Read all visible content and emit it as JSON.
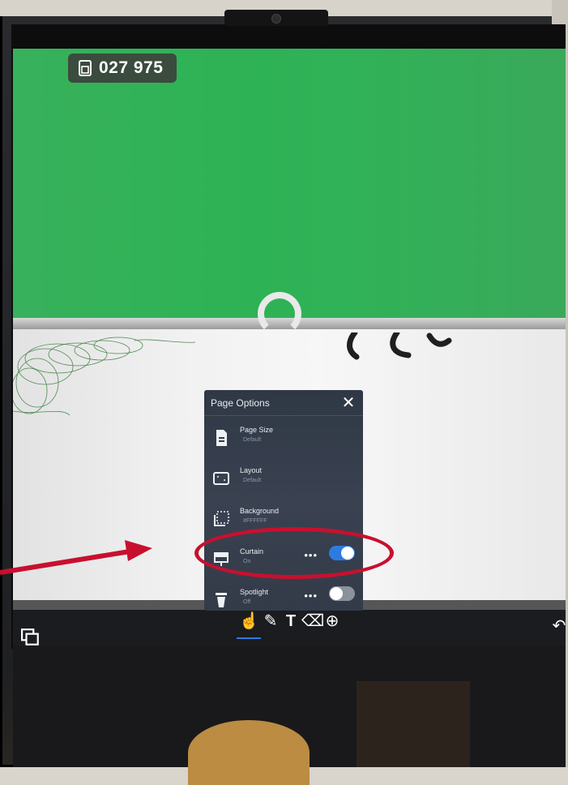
{
  "session_code": "027 975",
  "panel": {
    "title": "Page Options",
    "options": [
      {
        "label": "Page Size",
        "value": "Default",
        "icon": "page-size-icon"
      },
      {
        "label": "Layout",
        "value": "Default",
        "icon": "layout-icon"
      },
      {
        "label": "Background",
        "value": "#FFFFFF",
        "icon": "background-icon"
      },
      {
        "label": "Curtain",
        "value": "On",
        "icon": "curtain-icon",
        "toggle": true
      },
      {
        "label": "Spotlight",
        "value": "Off",
        "icon": "spotlight-icon",
        "toggle": false
      }
    ]
  },
  "toolbar": {
    "tools": [
      "pages-icon",
      "hand-select-icon",
      "pen-icon",
      "text-icon",
      "eraser-icon",
      "add-icon",
      "undo-icon"
    ],
    "active_tool": "hand-select-icon"
  },
  "colors": {
    "accent": "#2e7be0",
    "curtain": "#30b258",
    "annotation": "#c8102e"
  }
}
